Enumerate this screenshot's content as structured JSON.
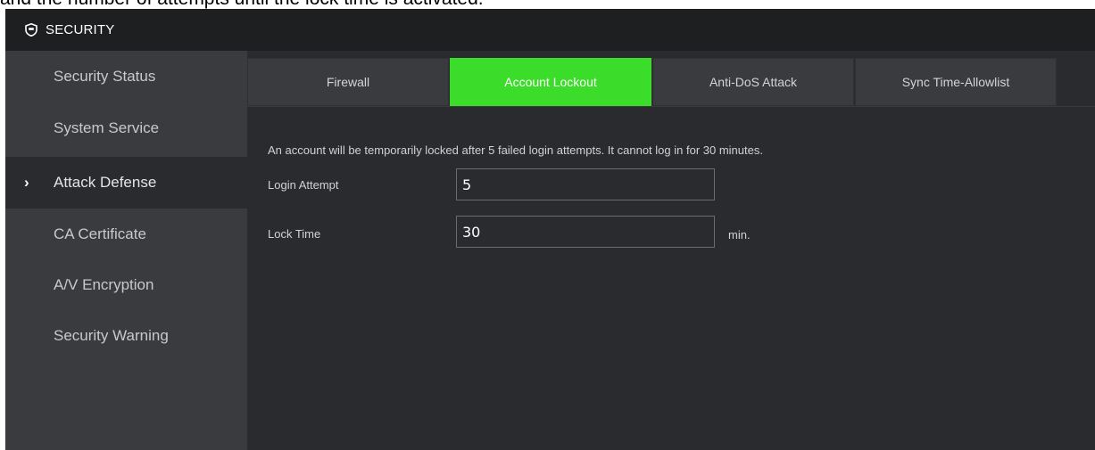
{
  "caption": "and the number of attempts until the lock time is activated.",
  "titlebar": {
    "title": "SECURITY",
    "icon": "shield-icon"
  },
  "sidebar": {
    "items": [
      {
        "label": "Security Status"
      },
      {
        "label": "System Service"
      },
      {
        "label": "Attack Defense",
        "active": true
      },
      {
        "label": "CA Certificate"
      },
      {
        "label": "A/V Encryption"
      },
      {
        "label": "Security Warning"
      }
    ],
    "active_marker": "›"
  },
  "tabs": [
    {
      "label": "Firewall"
    },
    {
      "label": "Account Lockout",
      "active": true
    },
    {
      "label": "Anti-DoS Attack"
    },
    {
      "label": "Sync Time-Allowlist"
    }
  ],
  "content": {
    "description": "An account will be temporarily locked after 5 failed login attempts. It cannot log in for 30 minutes.",
    "login_attempt": {
      "label": "Login Attempt",
      "value": "5"
    },
    "lock_time": {
      "label": "Lock Time",
      "value": "30",
      "unit": "min."
    }
  },
  "colors": {
    "accent": "#3cdc2a",
    "background": "#2a2b2f",
    "sidebar": "#3a3b3f",
    "titlebar": "#1e1f21"
  }
}
